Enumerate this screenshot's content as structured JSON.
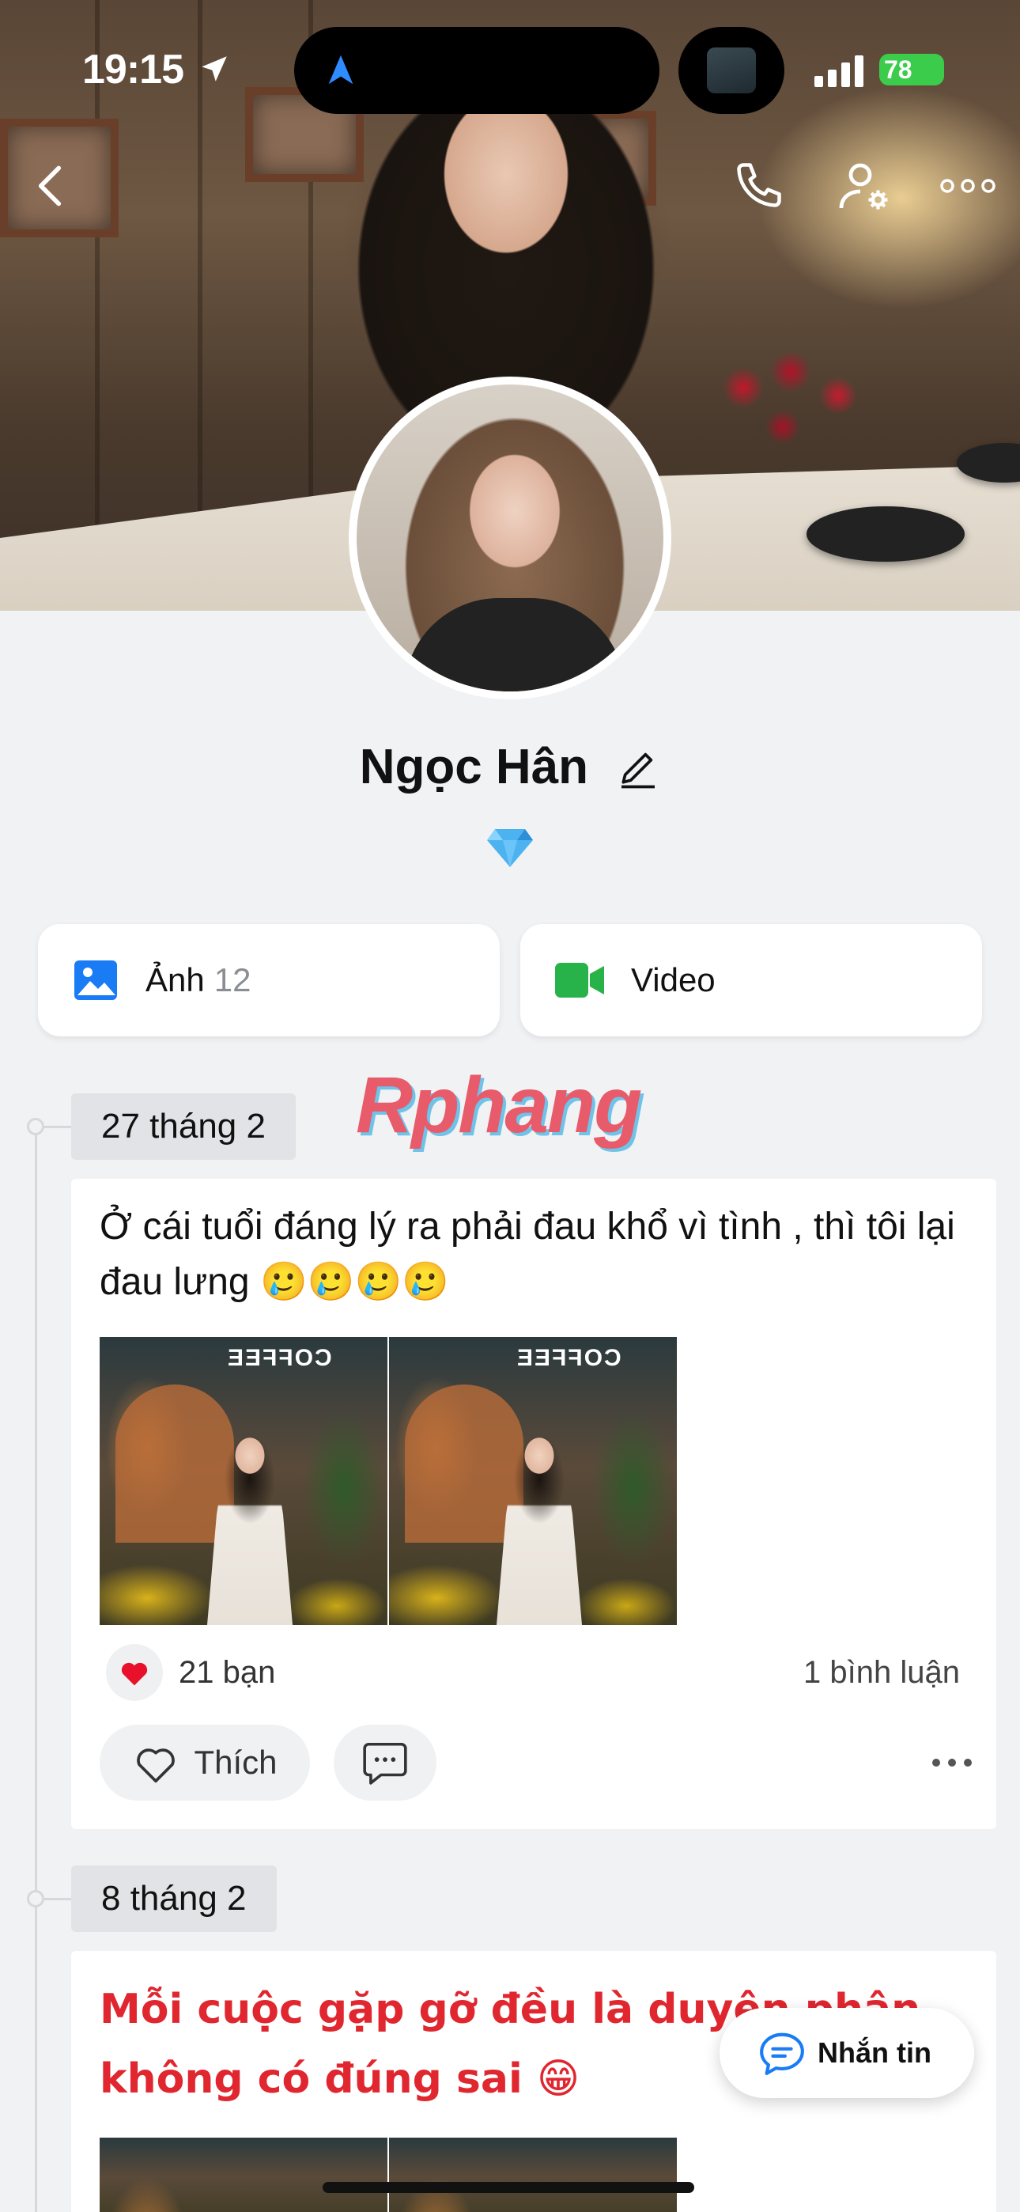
{
  "status_bar": {
    "time": "19:15",
    "battery": "78"
  },
  "profile": {
    "name": "Ngọc Hân"
  },
  "media": {
    "photos_label": "Ảnh",
    "photos_count": "12",
    "video_label": "Video"
  },
  "watermark": "Rphang",
  "posts": [
    {
      "date": "27 tháng 2",
      "text": "Ở cái tuổi đáng lý ra phải đau khổ vì tình , thì tôi lại đau lưng 🥲🥲🥲🥲",
      "photo_sign": "COFFEE",
      "reactions": "21 bạn",
      "comments": "1 bình luận",
      "like_label": "Thích"
    },
    {
      "date": "8 tháng 2",
      "text": "Mỗi cuộc gặp gỡ đều là duyên phận không có đúng sai 😁"
    }
  ],
  "message_button": {
    "label": "Nhắn tin"
  },
  "colors": {
    "accent_blue": "#1a7cf4",
    "red_text": "#e0262f",
    "heart": "#e8102a",
    "video_green": "#27b34a"
  }
}
